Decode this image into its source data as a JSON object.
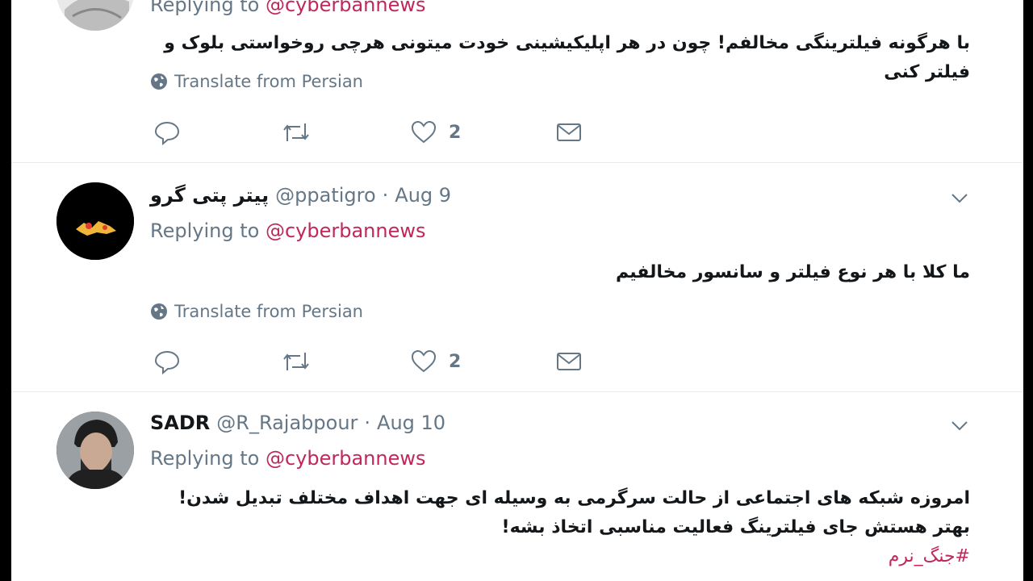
{
  "colors": {
    "link": "#c0285a",
    "text": "#14171a",
    "muted": "#657786",
    "divider": "#e6ecf0"
  },
  "tweets": [
    {
      "reply_label": "Replying to",
      "reply_handle": "@cyberbannews",
      "text": "با هرگونه فیلترینگی مخالفم! چون در هر اپلیکیشینی خودت میتونی هرچی روخواستی بلوک و فیلتر کنی",
      "translate": "Translate from Persian",
      "likes": "2"
    },
    {
      "display_name": "پیتر پتی گرو",
      "handle": "@ppatigro",
      "date": "Aug 9",
      "reply_label": "Replying to",
      "reply_handle": "@cyberbannews",
      "text": "ما کلا با هر نوع فیلتر و سانسور مخالفیم",
      "translate": "Translate from Persian",
      "likes": "2"
    },
    {
      "display_name": "SADR",
      "handle": "@R_Rajabpour",
      "date": "Aug 10",
      "reply_label": "Replying to",
      "reply_handle": "@cyberbannews",
      "text_line1": "امروزه شبکه های اجتماعی از حالت سرگرمی به وسیله ای جهت اهداف مختلف تبدیل شدن!",
      "text_line2": "بهتر هستش جای فیلترینگ فعالیت مناسبی اتخاذ بشه!",
      "hashtag": "#جنگ_نرم"
    }
  ],
  "separator_dot": "·"
}
